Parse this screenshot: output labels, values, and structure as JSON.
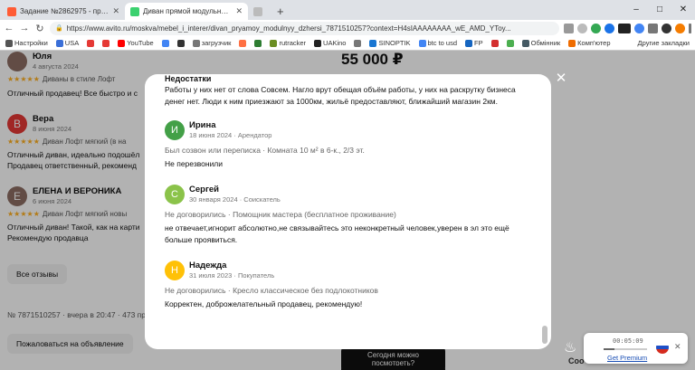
{
  "browser": {
    "tabs": [
      {
        "label": "Задание №2862975 - просмотр з",
        "icon_color": "#ff5c35",
        "active": false
      },
      {
        "label": "Диван прямой модульный Джерс",
        "icon_color": "#3bd16f",
        "active": true
      },
      {
        "label": "",
        "icon_color": "#bbbbbb",
        "active": false
      }
    ],
    "new_tab": "+",
    "window_controls": [
      "–",
      "□",
      "✕"
    ],
    "url": "https://www.avito.ru/moskva/mebel_i_interer/divan_pryamoy_modulnyy_dzhersi_7871510257?context=H4sIAAAAAAAA_wE_AMD_YToy...",
    "bookmarks": [
      {
        "label": "Настройки",
        "color": "#555555"
      },
      {
        "label": "USA",
        "color": "#3a6fd8"
      },
      {
        "label": "",
        "color": "#e53935"
      },
      {
        "label": "",
        "color": "#e53935"
      },
      {
        "label": "YouTube",
        "color": "#ff0000"
      },
      {
        "label": "",
        "color": "#4285f4"
      },
      {
        "label": "",
        "color": "#333333"
      },
      {
        "label": "загрузчик",
        "color": "#777777"
      },
      {
        "label": "",
        "color": "#ff7043"
      },
      {
        "label": "",
        "color": "#2e7d32"
      },
      {
        "label": "rutracker",
        "color": "#6b8e23"
      },
      {
        "label": "UAKino",
        "color": "#222222"
      },
      {
        "label": "",
        "color": "#777777"
      },
      {
        "label": "SINOPTIK",
        "color": "#1976d2"
      },
      {
        "label": "btc to usd",
        "color": "#4285f4"
      },
      {
        "label": "FP",
        "color": "#1565c0"
      },
      {
        "label": "",
        "color": "#d32f2f"
      },
      {
        "label": "",
        "color": "#4caf50"
      },
      {
        "label": "Обмінник",
        "color": "#455a64"
      },
      {
        "label": "Комп'ютер",
        "color": "#ef6c00"
      }
    ],
    "other_bookmarks": "Другие закладки",
    "ext_badge": "LTC 78.7"
  },
  "background": {
    "price": "55 000 ₽",
    "reviews": [
      {
        "initial": "",
        "name": "Юля",
        "date": "4 августа 2024",
        "rating": "Диваны в стиле Лофт",
        "lines": [
          "Отличный продавец! Все быстро и с"
        ],
        "color": "#8d6e63"
      },
      {
        "initial": "В",
        "name": "Вера",
        "date": "8 июня 2024",
        "rating": "Диван Лофт мягкий (в на",
        "lines": [
          "Отличный диван, идеально подошёл",
          "Продавец ответственный, рекоменд"
        ],
        "color": "#e53935"
      },
      {
        "initial": "Е",
        "name": "ЕЛЕНА И ВЕРОНИКА",
        "date": "6 июня 2024",
        "rating": "Диван Лофт мягкий новы",
        "lines": [
          "Отличный диван! Такой, как на карти",
          "Рекомендую продавца"
        ],
        "color": "#8d6e63"
      }
    ],
    "all_reviews_button": "Все отзывы",
    "meta": "№ 7871510257 · вчера в 20:47 · 473 прос",
    "report_button": "Пожаловаться на объявление",
    "ask_button": "Сегодня можно посмотреть?"
  },
  "modal": {
    "section_title": "Недостатки",
    "section_text": "Работы у них нет от слова Совсем. Нагло врут обещая объём работы, у них на раскрутку бизнеса денег нет. Люди к ним приезжают за 1000км, жильё предоставляют, ближайший магазин 2км.",
    "close_icon": "✕",
    "reviews": [
      {
        "initial": "И",
        "name": "Ирина",
        "date": "18 июня 2024 · Арендатор",
        "tags": "Был созвон или переписка · Комната 10 м² в 6-к., 2/3 эт.",
        "text": "Не перезвонили",
        "color": "#43a047"
      },
      {
        "initial": "С",
        "name": "Сергей",
        "date": "30 января 2024 · Соискатель",
        "tags": "Не договорились · Помощник мастера (бесплатное проживание)",
        "text": "не отвечает,игнорит абсолютно,не связывайтесь это неконкретный человек,уверен в эл это ещё больше проявиться.",
        "color": "#8bc34a"
      },
      {
        "initial": "Н",
        "name": "Надежда",
        "date": "31 июля 2023 · Покупатель",
        "tags": "Не договорились · Кресло классическое без подлокотников",
        "text": "Корректен, доброжелательный продавец, рекомендую!",
        "color": "#ffc107"
      }
    ]
  },
  "player": {
    "time": "00:05:09",
    "progress": 0.25,
    "link": "Get Premium",
    "close": "✕"
  },
  "edge_text": "Coo"
}
